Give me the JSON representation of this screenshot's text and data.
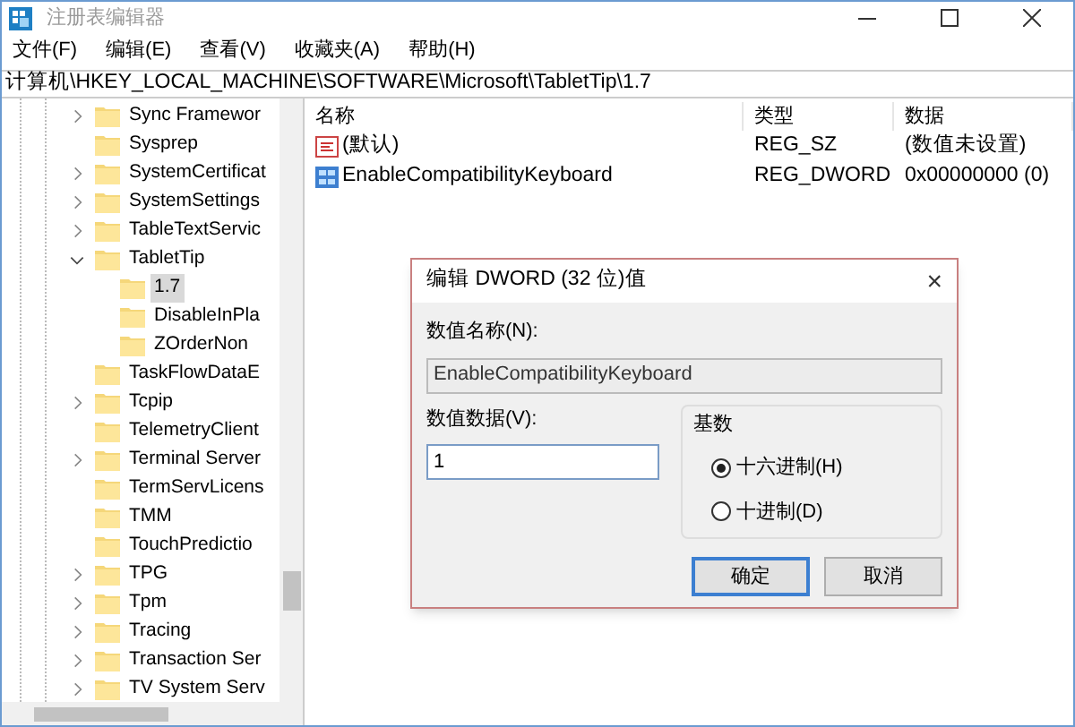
{
  "window": {
    "title": "注册表编辑器"
  },
  "menu": [
    {
      "label": "文件(F)"
    },
    {
      "label": "编辑(E)"
    },
    {
      "label": "查看(V)"
    },
    {
      "label": "收藏夹(A)"
    },
    {
      "label": "帮助(H)"
    }
  ],
  "address": "计算机\\HKEY_LOCAL_MACHINE\\SOFTWARE\\Microsoft\\TabletTip\\1.7",
  "tree": [
    {
      "label": "Sync Framewor",
      "expandable": true,
      "expanded": false,
      "selected": false
    },
    {
      "label": "Sysprep",
      "expandable": false,
      "expanded": false,
      "selected": false
    },
    {
      "label": "SystemCertificat",
      "expandable": true,
      "expanded": false,
      "selected": false
    },
    {
      "label": "SystemSettings",
      "expandable": true,
      "expanded": false,
      "selected": false
    },
    {
      "label": "TableTextServic",
      "expandable": true,
      "expanded": false,
      "selected": false
    },
    {
      "label": "TabletTip",
      "expandable": true,
      "expanded": true,
      "selected": false,
      "children": [
        {
          "label": "1.7",
          "expandable": false,
          "expanded": false,
          "selected": true
        },
        {
          "label": "DisableInPla",
          "expandable": false,
          "expanded": false,
          "selected": false
        },
        {
          "label": "ZOrderNon",
          "expandable": false,
          "expanded": false,
          "selected": false
        }
      ]
    },
    {
      "label": "TaskFlowDataE",
      "expandable": false,
      "expanded": false,
      "selected": false
    },
    {
      "label": "Tcpip",
      "expandable": true,
      "expanded": false,
      "selected": false
    },
    {
      "label": "TelemetryClient",
      "expandable": false,
      "expanded": false,
      "selected": false
    },
    {
      "label": "Terminal Server",
      "expandable": true,
      "expanded": false,
      "selected": false
    },
    {
      "label": "TermServLicens",
      "expandable": false,
      "expanded": false,
      "selected": false
    },
    {
      "label": "TMM",
      "expandable": false,
      "expanded": false,
      "selected": false
    },
    {
      "label": "TouchPredictio",
      "expandable": false,
      "expanded": false,
      "selected": false
    },
    {
      "label": "TPG",
      "expandable": true,
      "expanded": false,
      "selected": false
    },
    {
      "label": "Tpm",
      "expandable": true,
      "expanded": false,
      "selected": false
    },
    {
      "label": "Tracing",
      "expandable": true,
      "expanded": false,
      "selected": false
    },
    {
      "label": "Transaction Ser",
      "expandable": true,
      "expanded": false,
      "selected": false
    },
    {
      "label": "TV System Serv",
      "expandable": true,
      "expanded": false,
      "selected": false
    }
  ],
  "values_table": {
    "columns": [
      "名称",
      "类型",
      "数据"
    ],
    "rows": [
      {
        "kind": "string",
        "name": "(默认)",
        "type": "REG_SZ",
        "data": "(数值未设置)"
      },
      {
        "kind": "binary",
        "name": "EnableCompatibilityKeyboard",
        "type": "REG_DWORD",
        "data": "0x00000000 (0)"
      }
    ]
  },
  "dialog": {
    "title": "编辑 DWORD (32 位)值",
    "close": "×",
    "name_label": "数值名称(N):",
    "name_value": "EnableCompatibilityKeyboard",
    "data_label": "数值数据(V):",
    "data_value": "1",
    "base_label": "基数",
    "bases": [
      {
        "label": "十六进制(H)",
        "selected": true
      },
      {
        "label": "十进制(D)",
        "selected": false
      }
    ],
    "buttons": [
      {
        "label": "确定",
        "focused": true
      },
      {
        "label": "取消",
        "focused": false
      }
    ]
  }
}
